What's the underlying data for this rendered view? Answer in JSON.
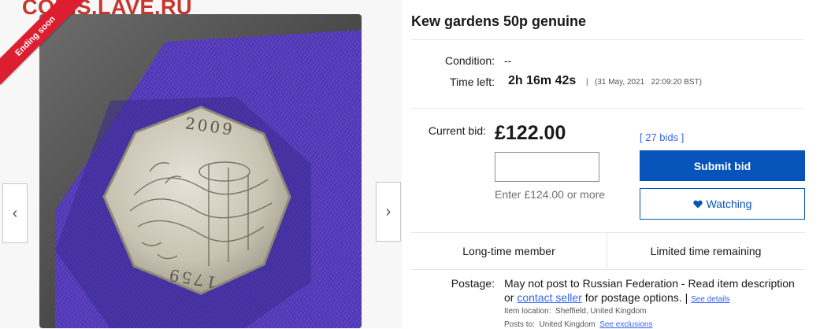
{
  "gallery": {
    "watermark": "COINS.LAVE.RU",
    "ribbon": "Ending soon",
    "prev_icon": "chevron-left-icon",
    "next_icon": "chevron-right-icon",
    "coin_year_top": "2009",
    "coin_year_bottom": "1759"
  },
  "listing": {
    "title": "Kew gardens 50p genuine",
    "condition_label": "Condition:",
    "condition_value": "--",
    "time_left_label": "Time left:",
    "time_left_value": "2h 16m 42s",
    "time_left_sep": "|",
    "end_time": "(31 May, 2021   22:09:20 BST)",
    "current_bid_label": "Current bid:",
    "current_bid_value": "£122.00",
    "bid_input_value": "",
    "bid_hint": "Enter £124.00 or more",
    "bids_count": "[ 27 bids ]",
    "submit_label": "Submit bid",
    "watching_label": "Watching",
    "watching_icon": "heart-icon",
    "feature_1": "Long-time member",
    "feature_2": "Limited time remaining"
  },
  "postage": {
    "label": "Postage:",
    "line1": "May not post to Russian Federation - Read item description",
    "line2_prefix": "or",
    "contact_link": "contact seller",
    "line2_suffix": "for postage options. |",
    "see_details": "See details",
    "location_label": "Item location:",
    "location_value": "Sheffield, United Kingdom",
    "posts_to_label": "Posts to:",
    "posts_to_value": "United Kingdom",
    "see_exclusions": "See exclusions"
  },
  "colors": {
    "primary_button": "#0654ba",
    "link": "#3665f3",
    "ribbon": "#dd1e31",
    "watermark": "#c7352c"
  }
}
